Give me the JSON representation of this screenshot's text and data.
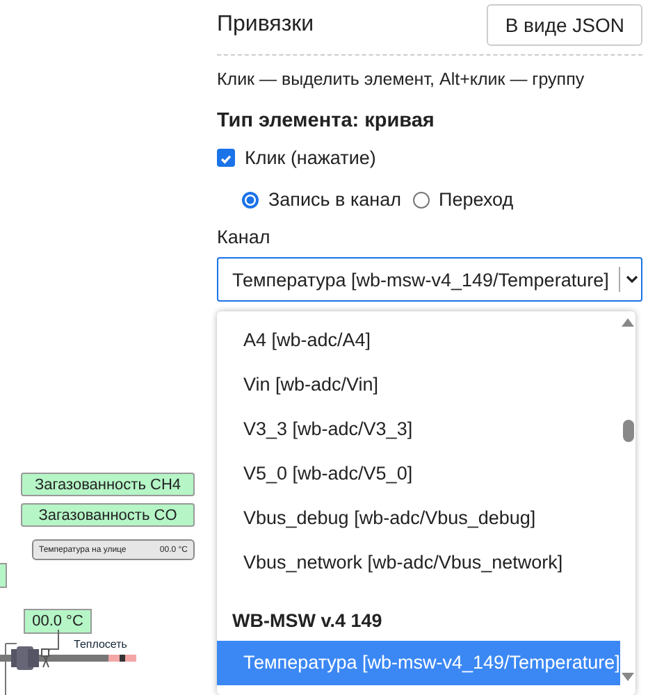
{
  "canvas": {
    "widgets": [
      {
        "kind": "label",
        "text": "Загазованность CH4"
      },
      {
        "kind": "label",
        "text": "Загазованность CO"
      },
      {
        "kind": "small",
        "text": "Температура на улице",
        "value": "00.0 °C"
      },
      {
        "kind": "stub"
      },
      {
        "kind": "value",
        "text": "00.0 °C"
      },
      {
        "kind": "pipe",
        "text": "Теплосеть"
      }
    ]
  },
  "panel": {
    "title": "Привязки",
    "json_button": "В виде JSON",
    "hint": "Клик — выделить элемент, Alt+клик — группу",
    "element_type": "Тип элемента: кривая",
    "click": {
      "label": "Клик (нажатие)",
      "checked": true
    },
    "modes": [
      {
        "label": "Запись в канал",
        "selected": true
      },
      {
        "label": "Переход",
        "selected": false
      }
    ],
    "channel_label": "Канал",
    "channel_value": "Температура [wb-msw-v4_149/Temperature]",
    "options": [
      {
        "kind": "option",
        "label": "A4 [wb-adc/A4]",
        "selected": false
      },
      {
        "kind": "option",
        "label": "Vin [wb-adc/Vin]",
        "selected": false
      },
      {
        "kind": "option",
        "label": "V3_3 [wb-adc/V3_3]",
        "selected": false
      },
      {
        "kind": "option",
        "label": "V5_0 [wb-adc/V5_0]",
        "selected": false
      },
      {
        "kind": "option",
        "label": "Vbus_debug [wb-adc/Vbus_debug]",
        "selected": false
      },
      {
        "kind": "option",
        "label": "Vbus_network [wb-adc/Vbus_network]",
        "selected": false
      },
      {
        "kind": "group",
        "label": "WB-MSW v.4 149"
      },
      {
        "kind": "option",
        "label": "Температура [wb-msw-v4_149/Temperature]",
        "selected": true
      }
    ]
  }
}
